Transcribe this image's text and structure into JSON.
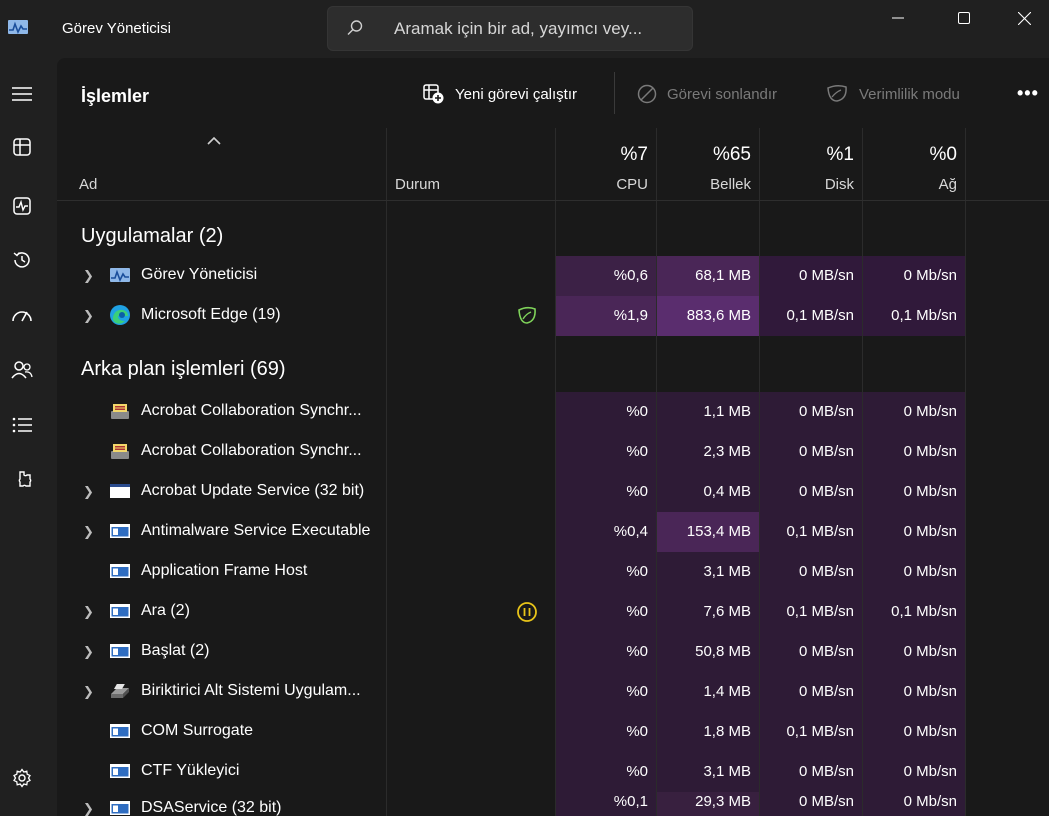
{
  "window": {
    "title": "Görev Yöneticisi",
    "search_placeholder": "Aramak için bir ad, yayımcı vey..."
  },
  "toolbar": {
    "page_title": "İşlemler",
    "run_new_task": "Yeni görevi çalıştır",
    "end_task": "Görevi sonlandır",
    "efficiency_mode": "Verimlilik modu",
    "more": "•••"
  },
  "nav": {
    "items": [
      "menu-icon",
      "processes-icon",
      "performance-icon",
      "app-history-icon",
      "startup-apps-icon",
      "users-icon",
      "details-icon",
      "services-icon",
      "settings-icon"
    ]
  },
  "header": {
    "name": "Ad",
    "status": "Durum",
    "cpu_pct": "%7",
    "cpu": "CPU",
    "mem_pct": "%65",
    "mem": "Bellek",
    "disk_pct": "%1",
    "disk": "Disk",
    "net_pct": "%0",
    "net": "Ağ"
  },
  "groups": {
    "apps": "Uygulamalar (2)",
    "background": "Arka plan işlemleri (69)"
  },
  "apps": [
    {
      "name": "Görev Yöneticisi",
      "icon": "task-manager-icon",
      "expandable": true,
      "status": "",
      "cpu": "%0,6",
      "mem": "68,1 MB",
      "disk": "0 MB/sn",
      "net": "0 Mb/sn"
    },
    {
      "name": "Microsoft Edge (19)",
      "icon": "edge-icon",
      "expandable": true,
      "status": "efficiency-leaf",
      "cpu": "%1,9",
      "mem": "883,6 MB",
      "disk": "0,1 MB/sn",
      "net": "0,1 Mb/sn"
    }
  ],
  "background": [
    {
      "name": "Acrobat Collaboration Synchr...",
      "icon": "acrobat-sync-icon",
      "expandable": false,
      "status": "",
      "cpu": "%0",
      "mem": "1,1 MB",
      "disk": "0 MB/sn",
      "net": "0 Mb/sn"
    },
    {
      "name": "Acrobat Collaboration Synchr...",
      "icon": "acrobat-sync-icon",
      "expandable": false,
      "status": "",
      "cpu": "%0",
      "mem": "2,3 MB",
      "disk": "0 MB/sn",
      "net": "0 Mb/sn"
    },
    {
      "name": "Acrobat Update Service (32 bit)",
      "icon": "white-window-icon",
      "expandable": true,
      "status": "",
      "cpu": "%0",
      "mem": "0,4 MB",
      "disk": "0 MB/sn",
      "net": "0 Mb/sn"
    },
    {
      "name": "Antimalware Service Executable",
      "icon": "app-window-icon",
      "expandable": true,
      "status": "",
      "cpu": "%0,4",
      "mem": "153,4 MB",
      "disk": "0,1 MB/sn",
      "net": "0 Mb/sn"
    },
    {
      "name": "Application Frame Host",
      "icon": "app-window-icon",
      "expandable": false,
      "status": "",
      "cpu": "%0",
      "mem": "3,1 MB",
      "disk": "0 MB/sn",
      "net": "0 Mb/sn"
    },
    {
      "name": "Ara (2)",
      "icon": "app-window-icon",
      "expandable": true,
      "status": "paused",
      "cpu": "%0",
      "mem": "7,6 MB",
      "disk": "0,1 MB/sn",
      "net": "0,1 Mb/sn"
    },
    {
      "name": "Başlat (2)",
      "icon": "app-window-icon",
      "expandable": true,
      "status": "",
      "cpu": "%0",
      "mem": "50,8 MB",
      "disk": "0 MB/sn",
      "net": "0 Mb/sn"
    },
    {
      "name": "Biriktirici Alt Sistemi Uygulam...",
      "icon": "printer-icon",
      "expandable": true,
      "status": "",
      "cpu": "%0",
      "mem": "1,4 MB",
      "disk": "0 MB/sn",
      "net": "0 Mb/sn"
    },
    {
      "name": "COM Surrogate",
      "icon": "app-window-icon",
      "expandable": false,
      "status": "",
      "cpu": "%0",
      "mem": "1,8 MB",
      "disk": "0,1 MB/sn",
      "net": "0 Mb/sn"
    },
    {
      "name": "CTF Yükleyici",
      "icon": "app-window-icon",
      "expandable": false,
      "status": "",
      "cpu": "%0",
      "mem": "3,1 MB",
      "disk": "0 MB/sn",
      "net": "0 Mb/sn"
    },
    {
      "name": "DSAService (32 bit)",
      "icon": "app-window-icon",
      "expandable": true,
      "status": "",
      "cpu": "%0,1",
      "mem": "29,3 MB",
      "disk": "0 MB/sn",
      "net": "0 Mb/sn"
    }
  ],
  "colors": {
    "heat_low": "#2f1d34",
    "heat_mid": "#3e2248",
    "heat_high": "#4e2a5e",
    "accent_leaf": "#7fd35a",
    "paused": "#e8c419"
  }
}
